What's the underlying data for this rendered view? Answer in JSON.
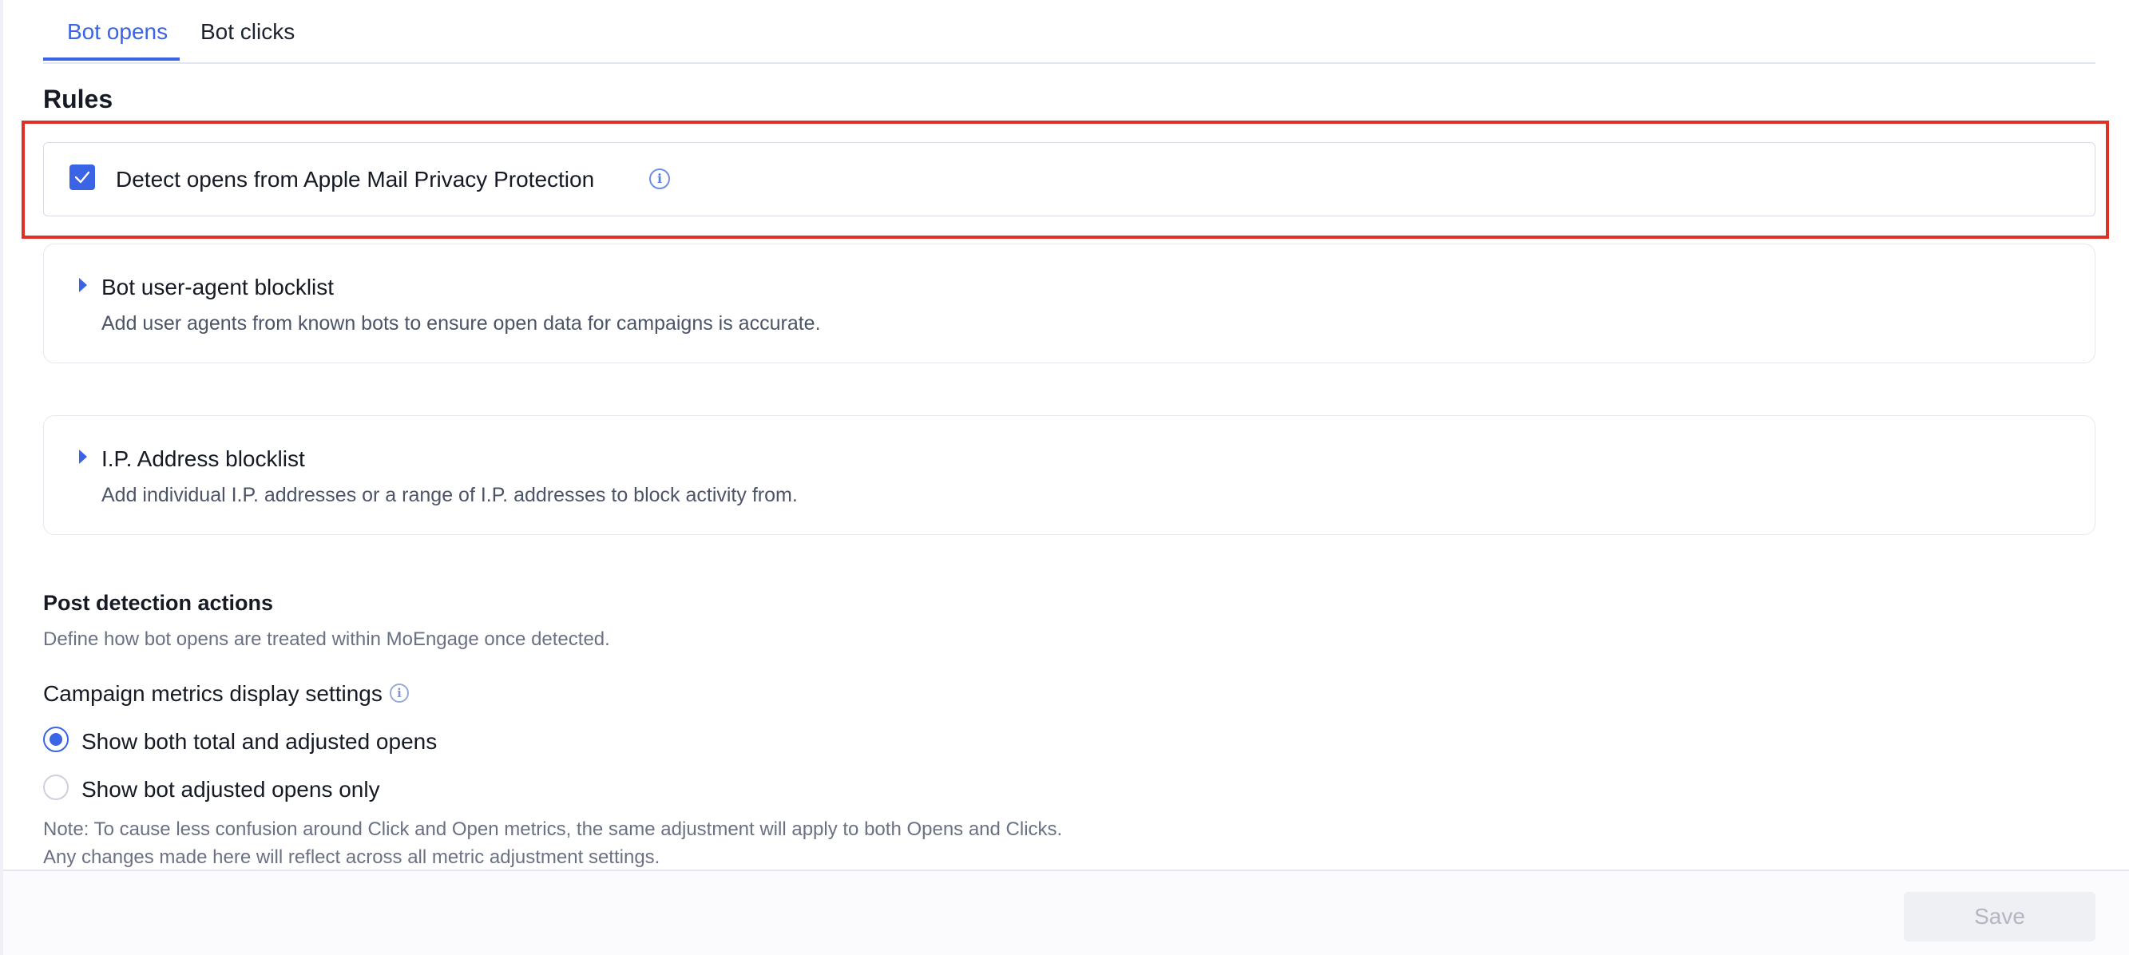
{
  "tabs": [
    {
      "label": "Bot opens",
      "active": true
    },
    {
      "label": "Bot clicks",
      "active": false
    }
  ],
  "rules": {
    "heading": "Rules",
    "detect_label": "Detect opens from Apple Mail Privacy Protection",
    "detect_checked": true,
    "info_icon_glyph": "i"
  },
  "accordions": [
    {
      "title": "Bot user-agent blocklist",
      "description": "Add user agents from known bots to ensure open data for campaigns is accurate."
    },
    {
      "title": "I.P. Address blocklist",
      "description": "Add individual I.P. addresses or a range of I.P. addresses to block activity from."
    }
  ],
  "post_detection": {
    "title": "Post detection actions",
    "description": "Define how bot opens are treated within MoEngage once detected.",
    "metrics_title": "Campaign metrics display settings",
    "options": [
      {
        "label": "Show both total and adjusted opens",
        "checked": true
      },
      {
        "label": "Show bot adjusted opens only",
        "checked": false
      }
    ],
    "note_line1": "Note: To cause less confusion around Click and Open metrics, the same adjustment will apply to both Opens and Clicks.",
    "note_line2": "Any changes made here will reflect across all metric adjustment settings."
  },
  "footer": {
    "save_label": "Save",
    "save_disabled": true
  },
  "colors": {
    "accent": "#3a63e6",
    "highlight": "#dc3124"
  }
}
